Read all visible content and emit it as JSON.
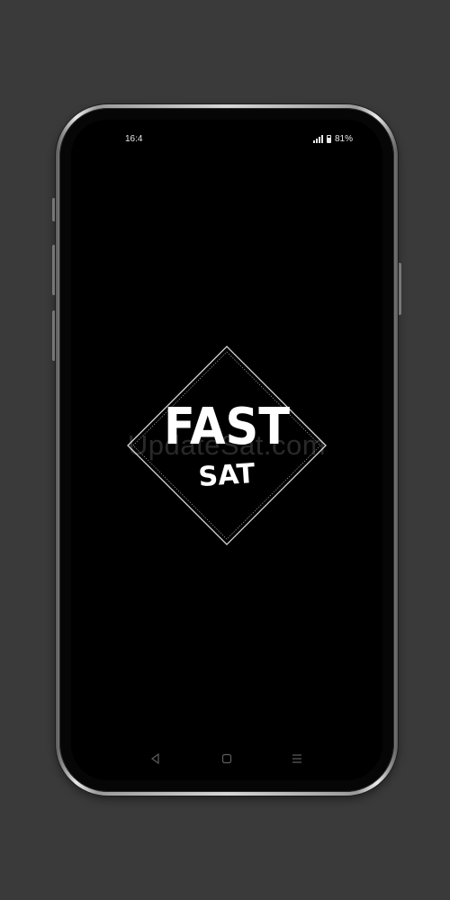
{
  "status_bar": {
    "time": "16:4",
    "battery_percent": "81%",
    "battery_level": 0.81,
    "icons": [
      "signal-icon",
      "battery-icon"
    ]
  },
  "splash": {
    "logo_text_top": "FAST",
    "logo_text_bottom": "SAT",
    "watermark": "UpdateSat.com"
  },
  "nav_bar": {
    "icons": [
      "back-icon",
      "home-icon",
      "recents-icon"
    ]
  },
  "colors": {
    "background": "#3a3a3a",
    "screen": "#000000",
    "logo_white": "#ffffff"
  }
}
